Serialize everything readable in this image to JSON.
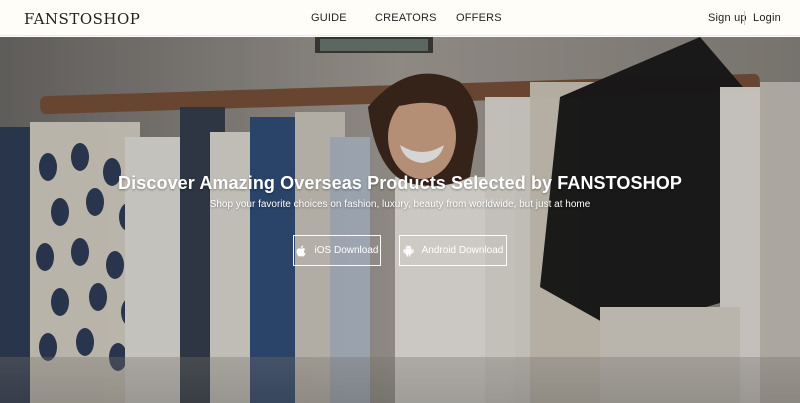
{
  "header": {
    "logo_text": "FANSTOSHOP",
    "nav": {
      "guide": "GUIDE",
      "creators": "CREATORS",
      "offers": "OFFERS"
    },
    "auth": {
      "signup": "Sign up",
      "login": "Login"
    }
  },
  "hero": {
    "headline": "Discover Amazing Overseas Products Selected by FANSTOSHOP",
    "subline": "Shop your favorite choices on fashion, luxury, beauty from worldwide, but just at home",
    "buttons": {
      "ios": {
        "label": "iOS Download",
        "icon": "apple-icon"
      },
      "android": {
        "label": "Android Download",
        "icon": "android-icon"
      }
    }
  },
  "colors": {
    "topbar_bg": "#fefdf8",
    "text_dark": "#222222",
    "hero_text": "#ffffff"
  }
}
